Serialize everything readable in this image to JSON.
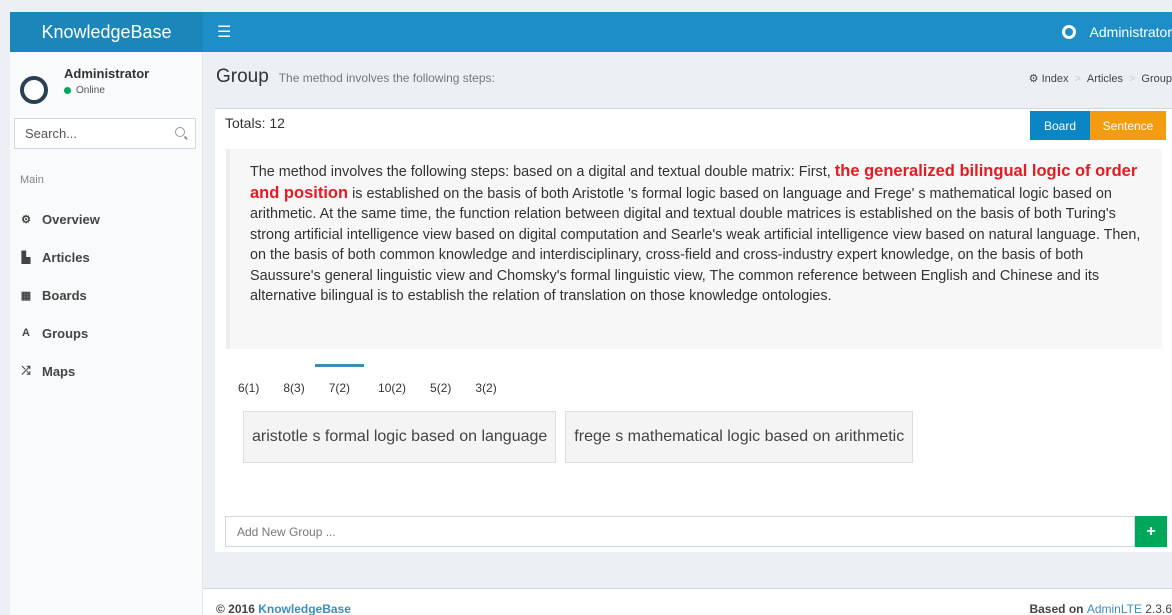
{
  "header": {
    "logo": "KnowledgeBase",
    "menu_icon": "hamburger-icon",
    "user": "Administrator"
  },
  "sidebar": {
    "user_name": "Administrator",
    "status": "Online",
    "search_placeholder": "Search...",
    "section": "Main",
    "items": [
      {
        "label": "Overview",
        "icon": "dashboard-icon",
        "glyph": "⚙"
      },
      {
        "label": "Articles",
        "icon": "file-icon",
        "glyph": "▙"
      },
      {
        "label": "Boards",
        "icon": "table-icon",
        "glyph": "▦"
      },
      {
        "label": "Groups",
        "icon": "font-icon",
        "glyph": "A"
      },
      {
        "label": "Maps",
        "icon": "random-icon",
        "glyph": "⤮"
      }
    ]
  },
  "page": {
    "title": "Group",
    "subtitle": "The method involves the following steps:",
    "breadcrumb": [
      "Index",
      "Articles",
      "Group"
    ]
  },
  "box": {
    "totals": "Totals: 12",
    "board_label": "Board",
    "sentence_label": "Sentence",
    "text_before": "The method involves the following steps: based on a digital and textual double matrix: First, ",
    "highlight": "the generalized bilingual logic of order and position",
    "text_after": " is established on the basis of both Aristotle 's formal logic based on language and Frege' s mathematical logic based on arithmetic. At the same time, the function relation between digital and textual double matrices is established on the basis of both Turing's strong artificial intelligence view based on digital computation and Searle's weak artificial intelligence view based on natural language. Then, on the basis of both common knowledge and interdisciplinary, cross-field and cross-industry expert knowledge, on the basis of both Saussure's general linguistic view and Chomsky's formal linguistic view, The common reference between English and Chinese and its alternative bilingual is to establish the relation of translation on those knowledge ontologies.",
    "tabs": [
      "6(1)",
      "8(3)",
      "7(2)",
      "10(2)",
      "5(2)",
      "3(2)"
    ],
    "active_tab": "7(2)",
    "chips": [
      "aristotle s formal logic based on language",
      "frege s mathematical logic based on arithmetic"
    ],
    "add_placeholder": "Add New Group ...",
    "add_button": "+"
  },
  "footer": {
    "copyright": "© 2016 ",
    "brand": "KnowledgeBase",
    "based_on": "Based on ",
    "adminlte": "AdminLTE",
    "version": " 2.3.6"
  },
  "colors": {
    "header": "#1e8fc6",
    "board": "#0a86c5",
    "sentence": "#f39c12",
    "highlight": "#e31b23",
    "add": "#00a65a"
  }
}
